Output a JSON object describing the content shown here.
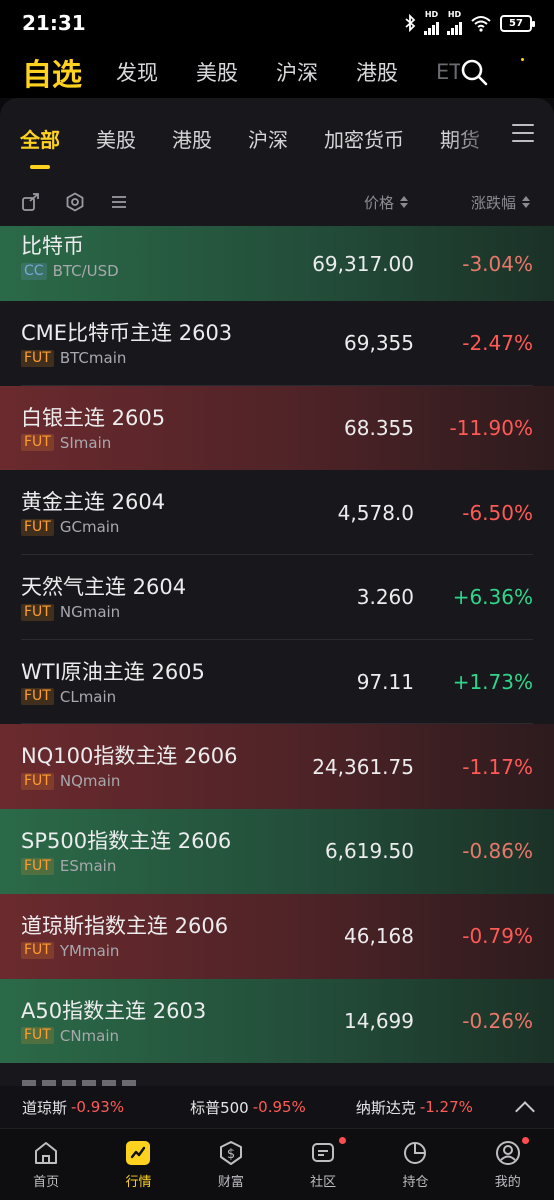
{
  "status": {
    "time": "21:31",
    "battery": "57",
    "hd1": "HD",
    "hd2": "HD"
  },
  "topnav": {
    "main": "自选",
    "tabs": [
      "发现",
      "美股",
      "沪深",
      "港股",
      "ETF"
    ]
  },
  "subtabs": [
    "全部",
    "美股",
    "港股",
    "沪深",
    "加密货币",
    "期货"
  ],
  "header": {
    "price": "价格",
    "change": "涨跌幅"
  },
  "rows": [
    {
      "name": "比特币",
      "badge": "CC",
      "symbol": "BTC/USD",
      "price": "69,317.00",
      "change": "-3.04%"
    },
    {
      "name": "CME比特币主连 2603",
      "badge": "FUT",
      "symbol": "BTCmain",
      "price": "69,355",
      "change": "-2.47%"
    },
    {
      "name": "白银主连 2605",
      "badge": "FUT",
      "symbol": "SImain",
      "price": "68.355",
      "change": "-11.90%"
    },
    {
      "name": "黄金主连 2604",
      "badge": "FUT",
      "symbol": "GCmain",
      "price": "4,578.0",
      "change": "-6.50%"
    },
    {
      "name": "天然气主连 2604",
      "badge": "FUT",
      "symbol": "NGmain",
      "price": "3.260",
      "change": "+6.36%"
    },
    {
      "name": "WTI原油主连 2605",
      "badge": "FUT",
      "symbol": "CLmain",
      "price": "97.11",
      "change": "+1.73%"
    },
    {
      "name": "NQ100指数主连 2606",
      "badge": "FUT",
      "symbol": "NQmain",
      "price": "24,361.75",
      "change": "-1.17%"
    },
    {
      "name": "SP500指数主连 2606",
      "badge": "FUT",
      "symbol": "ESmain",
      "price": "6,619.50",
      "change": "-0.86%"
    },
    {
      "name": "道琼斯指数主连 2606",
      "badge": "FUT",
      "symbol": "YMmain",
      "price": "46,168",
      "change": "-0.79%"
    },
    {
      "name": "A50指数主连 2603",
      "badge": "FUT",
      "symbol": "CNmain",
      "price": "14,699",
      "change": "-0.26%"
    }
  ],
  "ticker": [
    {
      "name": "道琼斯",
      "value": "-0.93%"
    },
    {
      "name": "标普500",
      "value": "-0.95%"
    },
    {
      "name": "纳斯达克",
      "value": "-1.27%"
    }
  ],
  "bottomnav": [
    "首页",
    "行情",
    "财富",
    "社区",
    "持仓",
    "我的"
  ],
  "colors": {
    "accent": "#ffd21f",
    "down": "#ff5a55",
    "up": "#2fd68a"
  }
}
